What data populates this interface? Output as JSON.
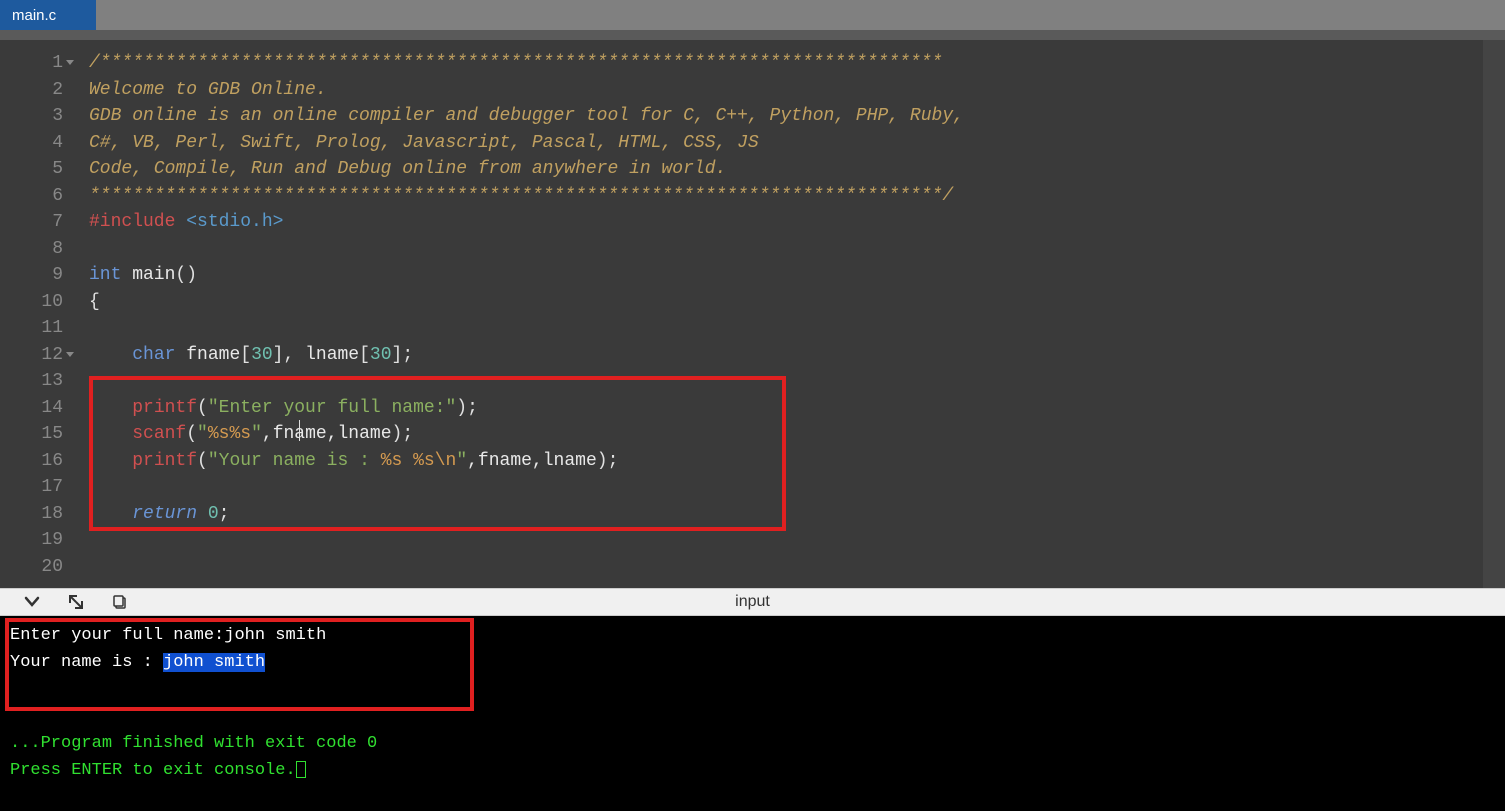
{
  "tab": {
    "name": "main.c"
  },
  "gutter": [
    "1",
    "2",
    "3",
    "4",
    "5",
    "6",
    "7",
    "8",
    "9",
    "10",
    "11",
    "12",
    "13",
    "14",
    "15",
    "16",
    "17",
    "18",
    "19",
    "20"
  ],
  "code": {
    "star_open": "/******************************************************************************",
    "blank": "",
    "c3": "Welcome to GDB Online.",
    "c4": "GDB online is an online compiler and debugger tool for C, C++, Python, PHP, Ruby, ",
    "c5": "C#, VB, Perl, Swift, Prolog, Javascript, Pascal, HTML, CSS, JS",
    "c6": "Code, Compile, Run and Debug online from anywhere in world.",
    "star_close": "*******************************************************************************/",
    "include_kw": "#include ",
    "include_hdr": "<stdio.h>",
    "int_kw": "int",
    "main_id": " main",
    "paren": "()",
    "brace_open": "{",
    "indent1": "    ",
    "char_kw": "char",
    "fname_id": " fname",
    "br_open": "[",
    "size30a": "30",
    "br_close": "]",
    "comma": ", ",
    "lname_id": "lname",
    "size30b": "30",
    "semi": ";",
    "printf": "printf",
    "lp": "(",
    "rp": ")",
    "str1": "\"Enter your full name:\"",
    "scanf": "scanf",
    "str2_q1": "\"",
    "str2_body": "%s%s",
    "str2_q2": "\"",
    "arglist2": ",fname,lname",
    "str3_q1": "\"",
    "str3_part1": "Your name is : ",
    "str3_fmt": "%s %s",
    "str3_esc": "\\n",
    "str3_q2": "\"",
    "arglist3": ",fname,lname",
    "return_kw": "return",
    "zero": " 0"
  },
  "toolbar": {
    "input_label": "input"
  },
  "console": {
    "line1a": "Enter your full name:",
    "line1b": "john smith",
    "line2a": "Your name is : ",
    "line2b": "john smith",
    "exit1": "...Program finished with exit code 0",
    "exit2": "Press ENTER to exit console."
  }
}
